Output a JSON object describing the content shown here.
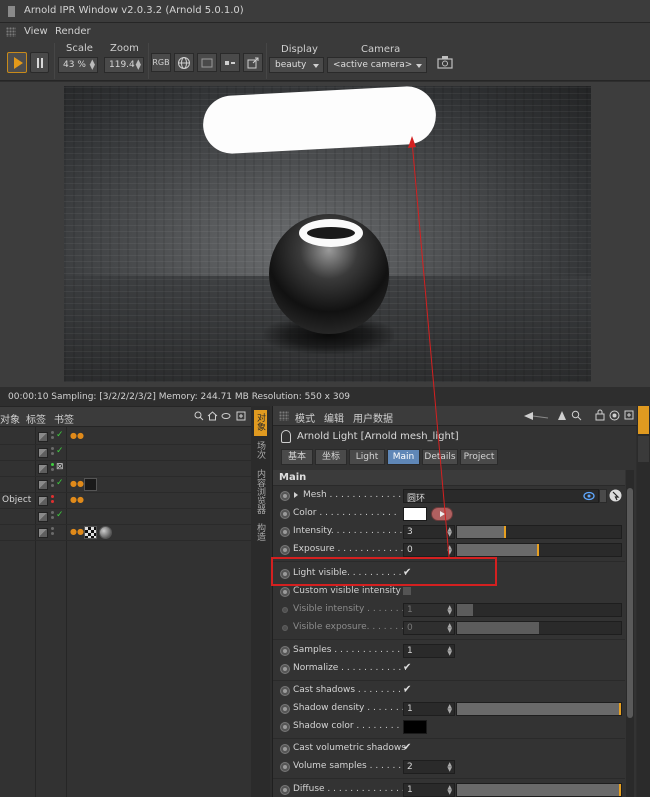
{
  "window": {
    "title": "Arnold IPR Window v2.0.3.2 (Arnold 5.0.1.0)"
  },
  "menu": {
    "items": [
      "View",
      "Render"
    ]
  },
  "toolbar": {
    "scale_label": "Scale",
    "scale_value": "43 %",
    "zoom_label": "Zoom",
    "zoom_value": "119.4",
    "rgb_label": "RGB",
    "display_label": "Display",
    "display_value": "beauty",
    "camera_label": "Camera",
    "camera_value": "<active camera>"
  },
  "status": {
    "text": "00:00:10  Sampling: [3/2/2/2/3/2]  Memory: 244.71 MB  Resolution: 550 x 309"
  },
  "object_manager": {
    "menu": [
      "对象",
      "标签",
      "书签"
    ],
    "rows": [
      {
        "name": ""
      },
      {
        "name": ""
      },
      {
        "name": ""
      },
      {
        "name": ""
      },
      {
        "name": "Object"
      },
      {
        "name": ""
      },
      {
        "name": ""
      }
    ],
    "side_tabs": [
      "对象",
      "场次",
      "内容浏览器",
      "构造"
    ]
  },
  "attributes": {
    "menu": [
      "模式",
      "编辑",
      "用户数据"
    ],
    "title": "Arnold Light [Arnold mesh_light]",
    "tabs": [
      "基本",
      "坐标",
      "Light",
      "Main",
      "Details",
      "Project"
    ],
    "active_tab": "Main",
    "section": "Main",
    "params": {
      "mesh_label": "Mesh . . . . . . . . . . . . . .",
      "mesh_value": "圆环",
      "color_label": "Color . . . . . . . . . . . . . .",
      "intensity_label": "Intensity. . . . . . . . . . . . .",
      "intensity_value": "3",
      "exposure_label": "Exposure . . . . . . . . . . . .",
      "exposure_value": "0",
      "light_visible_label": "Light visible. . . . . . . . . . .",
      "custom_visible_label": "Custom visible intensity",
      "visible_intensity_label": "Visible intensity . . . . . . .",
      "visible_intensity_value": "1",
      "visible_exposure_label": "Visible exposure. . . . . . . .",
      "visible_exposure_value": "0",
      "samples_label": "Samples . . . . . . . . . . . . .",
      "samples_value": "1",
      "normalize_label": "Normalize . . . . . . . . . . . .",
      "cast_shadows_label": "Cast shadows . . . . . . . . .",
      "shadow_density_label": "Shadow density . . . . . . . .",
      "shadow_density_value": "1",
      "shadow_color_label": "Shadow color . . . . . . . .",
      "cast_volumetric_label": "Cast volumetric shadows",
      "volume_samples_label": "Volume samples . . . . . . .",
      "volume_samples_value": "2",
      "diffuse_label": "Diffuse . . . . . . . . . . . . . .",
      "diffuse_value": "1",
      "check_glyph": "✔"
    },
    "slider_levels": {
      "intensity": 0.3,
      "exposure": 0.5,
      "visible_intensity": 0.1,
      "visible_exposure": 0.5,
      "shadow_density": 1.0,
      "diffuse": 1.0
    },
    "colors": {
      "light_color": "#ffffff",
      "shadow_color": "#000000",
      "accent": "#e09a20",
      "tab_active": "#5f87b7",
      "highlight": "#d42020"
    }
  }
}
